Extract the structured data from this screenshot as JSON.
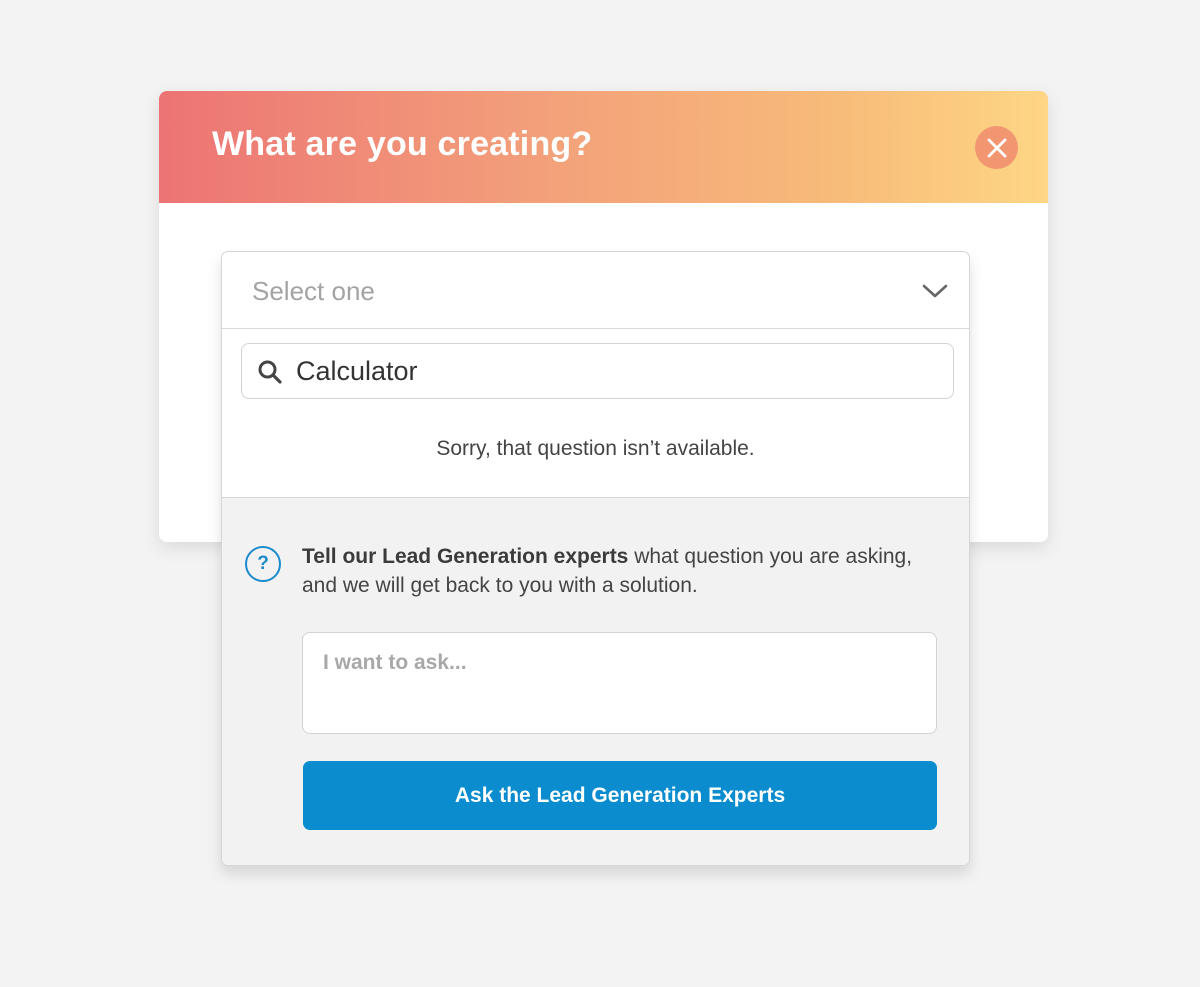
{
  "modal": {
    "title": "What are you creating?",
    "close_icon": "close-icon",
    "gradient_colors": [
      "#ec7474",
      "#f3a27a",
      "#f7ba79",
      "#fed685"
    ]
  },
  "dropdown": {
    "selected_placeholder": "Select one",
    "chevron_icon": "chevron-down-icon",
    "search": {
      "icon": "search-icon",
      "value": "Calculator"
    },
    "empty_message": "Sorry, that question isn’t available."
  },
  "help": {
    "icon": "question-circle-icon",
    "bold_text": "Tell our Lead Generation experts",
    "rest_text": " what question you are asking, and we will get back to you with a solution.",
    "input_placeholder": "I want to ask...",
    "button_label": "Ask the Lead Generation Experts",
    "accent_color": "#0a8ccf"
  }
}
